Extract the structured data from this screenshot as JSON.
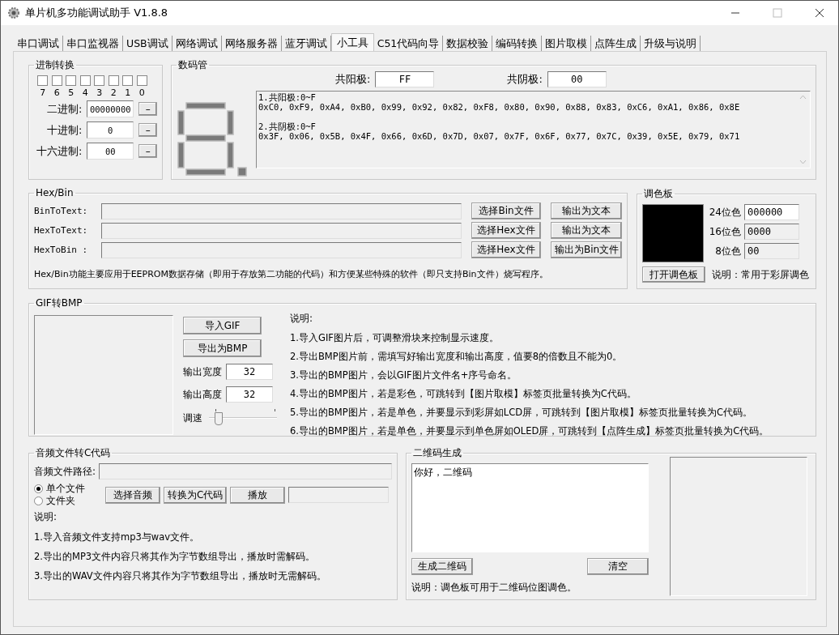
{
  "window": {
    "title": "单片机多功能调试助手 V1.8.8"
  },
  "tabs": [
    {
      "label": "串口调试",
      "selected": false
    },
    {
      "label": "串口监视器",
      "selected": false
    },
    {
      "label": "USB调试",
      "selected": false
    },
    {
      "label": "网络调试",
      "selected": false
    },
    {
      "label": "网络服务器",
      "selected": false
    },
    {
      "label": "蓝牙调试",
      "selected": false
    },
    {
      "label": "小工具",
      "selected": true
    },
    {
      "label": "C51代码向导",
      "selected": false
    },
    {
      "label": "数据校验",
      "selected": false
    },
    {
      "label": "编码转换",
      "selected": false
    },
    {
      "label": "图片取模",
      "selected": false
    },
    {
      "label": "点阵生成",
      "selected": false
    },
    {
      "label": "升级与说明",
      "selected": false
    }
  ],
  "number_conversion": {
    "title": "进制转换",
    "bits": [
      {
        "label": "7",
        "checked": false
      },
      {
        "label": "6",
        "checked": false
      },
      {
        "label": "5",
        "checked": false
      },
      {
        "label": "4",
        "checked": false
      },
      {
        "label": "3",
        "checked": false
      },
      {
        "label": "2",
        "checked": false
      },
      {
        "label": "1",
        "checked": false
      },
      {
        "label": "0",
        "checked": false
      }
    ],
    "fields": [
      {
        "label": "二进制:",
        "value": "00000000",
        "button": "–"
      },
      {
        "label": "十进制:",
        "value": "0",
        "button": "–"
      },
      {
        "label": "十六进制:",
        "value": "00",
        "button": "–"
      }
    ]
  },
  "seven_segment": {
    "title": "数码管",
    "common_anode": {
      "label": "共阳极:",
      "value": "FF"
    },
    "common_cathode": {
      "label": "共阴极:",
      "value": "00"
    },
    "codes": [
      "1.共阳极:0~F",
      "0xC0, 0xF9, 0xA4, 0xB0, 0x99, 0x92, 0x82, 0xF8, 0x80, 0x90, 0x88, 0x83, 0xC6, 0xA1, 0x86, 0x8E",
      "2.共阴极:0~F",
      "0x3F, 0x06, 0x5B, 0x4F, 0x66, 0x6D, 0x7D, 0x07, 0x7F, 0x6F, 0x77, 0x7C, 0x39, 0x5E, 0x79, 0x71"
    ]
  },
  "hex_bin": {
    "title": "Hex/Bin",
    "rows": [
      {
        "label": "BinToText:",
        "select_button": "选择Bin文件",
        "output_button": "输出为文本"
      },
      {
        "label": "HexToText:",
        "select_button": "选择Hex文件",
        "output_button": "输出为文本"
      },
      {
        "label": "HexToBin :",
        "select_button": "选择Hex文件",
        "output_button": "输出为Bin文件"
      }
    ],
    "note": "Hex/Bin功能主要应用于EEPROM数据存储（即用于存放第二功能的代码）和方便某些特殊的软件（即只支持Bin文件）烧写程序。"
  },
  "palette": {
    "title": "调色板",
    "fields": [
      {
        "label": "24位色",
        "value": "000000"
      },
      {
        "label": "16位色",
        "value": "0000"
      },
      {
        "label": "8位色",
        "value": "00"
      }
    ],
    "button": "打开调色板",
    "note": "说明：常用于彩屏调色"
  },
  "gif_to_bmp": {
    "title": "GIF转BMP",
    "import_button": "导入GIF",
    "export_button": "导出为BMP",
    "width": {
      "label": "输出宽度",
      "value": "32"
    },
    "height": {
      "label": "输出高度",
      "value": "32"
    },
    "speed": {
      "label": "调速",
      "level": 0.1
    },
    "notes_title": "说明:",
    "notes": [
      "1.导入GIF图片后，可调整滑块来控制显示速度。",
      "2.导出BMP图片前，需填写好输出宽度和输出高度，值要8的倍数且不能为0。",
      "3.导出的BMP图片，会以GIF图片文件名+序号命名。",
      "4.导出的BMP图片，若是彩色，可跳转到【图片取模】标签页批量转换为C代码。",
      "5.导出的BMP图片，若是单色，并要显示到彩屏如LCD屏，可跳转到【图片取模】标签页批量转换为C代码。",
      "6.导出的BMP图片，若是单色，并要显示到单色屏如OLED屏，可跳转到【点阵生成】标签页批量转换为C代码。"
    ]
  },
  "audio": {
    "title": "音频文件转C代码",
    "path_label": "音频文件路径:",
    "modes": [
      {
        "label": "单个文件",
        "selected": true
      },
      {
        "label": "文件夹",
        "selected": false
      }
    ],
    "buttons": [
      "选择音频",
      "转换为C代码",
      "播放"
    ],
    "notes_title": "说明:",
    "notes": [
      "1.导入音频文件支持mp3与wav文件。",
      "2.导出的MP3文件内容只将其作为字节数组导出，播放时需解码。",
      "3.导出的WAV文件内容只将其作为字节数组导出，播放时无需解码。"
    ]
  },
  "qr_code": {
    "title": "二维码生成",
    "text": "你好，二维码",
    "generate_button": "生成二维码",
    "clear_button": "清空",
    "note": "说明：调色板可用于二维码位图调色。"
  }
}
